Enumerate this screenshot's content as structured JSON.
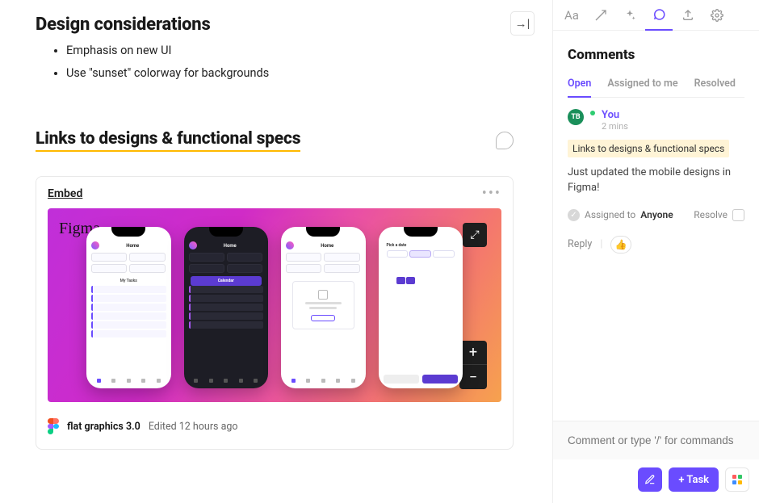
{
  "doc": {
    "heading1": "Design considerations",
    "bullets": [
      "Emphasis on new UI",
      "Use \"sunset\" colorway for backgrounds"
    ],
    "heading2": "Links to designs & functional specs"
  },
  "embed": {
    "title": "Embed",
    "figma_logo": "Figma",
    "file_name": "flat graphics 3.0",
    "edited": "Edited 12 hours ago",
    "phones": {
      "home_title": "Home",
      "calendar_title": "Pick a date"
    }
  },
  "toolbar": {
    "text_icon": "Aa"
  },
  "sidebar": {
    "title": "Comments",
    "tabs": {
      "open": "Open",
      "assigned": "Assigned to me",
      "resolved": "Resolved"
    }
  },
  "thread": {
    "avatar_initials": "TB",
    "author": "You",
    "time": "2 mins",
    "reference": "Links to designs & functional specs",
    "message": "Just updated the mobile designs in Figma!",
    "assigned_label": "Assigned to",
    "assigned_to": "Anyone",
    "resolve_label": "Resolve",
    "reply_label": "Reply"
  },
  "composer": {
    "placeholder": "Comment or type '/' for commands",
    "task_button": "+  Task"
  }
}
